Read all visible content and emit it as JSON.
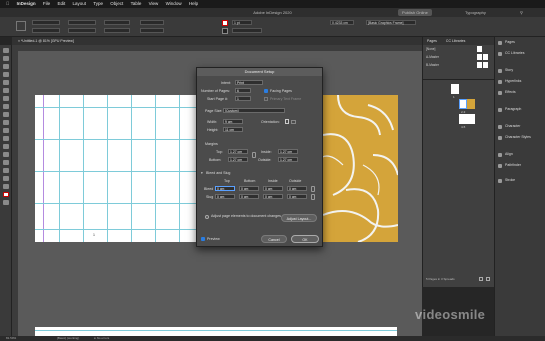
{
  "menubar": {
    "apple_icon": "apple-icon",
    "items": [
      "InDesign",
      "File",
      "Edit",
      "Layout",
      "Type",
      "Object",
      "Table",
      "View",
      "Window",
      "Help"
    ]
  },
  "window": {
    "title": "Adobe InDesign 2020"
  },
  "controlbar": {
    "publish_label": "Publish Online",
    "workspace_label": "Typography",
    "zoom_value": "1 pt",
    "stroke_value": "0.4233 cm",
    "frame_label": "[Basic Graphics Frame]"
  },
  "document_tab": {
    "label": "*Untitled-1 @ 81% [GPU Preview]"
  },
  "statusbar": {
    "zoom": "81.59%",
    "style": "[Basic] (working)",
    "errors": "No errors"
  },
  "pages_panel": {
    "tabs": [
      "Pages",
      "CC Libraries"
    ],
    "masters": [
      "[None]",
      "A-Master",
      "B-Master"
    ],
    "spread_labels": [
      "1",
      "2-3",
      "4-5"
    ],
    "footer": "5 Pages in 3 Spreads"
  },
  "right_panel": {
    "items": [
      "Pages",
      "CC Libraries",
      "Story",
      "Hyperlinks",
      "Effects",
      "Paragraph",
      "Character",
      "Character Styles",
      "Align",
      "Pathfinder",
      "Stroke"
    ]
  },
  "canvas": {
    "page_number": "1"
  },
  "dialog": {
    "title": "Document Setup",
    "intent_label": "Intent:",
    "intent_value": "Print",
    "num_pages_label": "Number of Pages:",
    "num_pages_value": "6",
    "start_page_label": "Start Page #:",
    "start_page_value": "1",
    "facing_pages_label": "Facing Pages",
    "primary_frame_label": "Primary Text Frame",
    "page_size_label": "Page Size:",
    "page_size_value": "[Custom]",
    "width_label": "Width:",
    "width_value": "9 cm",
    "height_label": "Height:",
    "height_value": "11 cm",
    "orientation_label": "Orientation:",
    "margins_label": "Margins",
    "top_label": "Top:",
    "top_value": "1,27 cm",
    "bottom_label": "Bottom:",
    "bottom_value": "1,27 cm",
    "inside_label": "Inside:",
    "inside_value": "1,27 cm",
    "outside_label": "Outside:",
    "outside_value": "1,27 cm",
    "bleed_slug_label": "Bleed and Slug",
    "col_headers": [
      "Top",
      "Bottom",
      "Inside",
      "Outside"
    ],
    "bleed_label": "Bleed",
    "bleed_values": [
      "0 cm",
      "0 cm",
      "0 cm",
      "0 cm"
    ],
    "slug_label": "Slug",
    "slug_values": [
      "0 cm",
      "0 cm",
      "0 cm",
      "0 cm"
    ],
    "adjust_label": "Adjust page elements to document changes",
    "adjust_button": "Adjust Layout...",
    "preview_label": "Preview",
    "cancel_label": "Cancel",
    "ok_label": "OK"
  },
  "watermark": "videosmile",
  "colors": {
    "accent": "#d4a43a",
    "guides": "#7ecbd9",
    "dialog_bg": "#4b4b4b"
  }
}
